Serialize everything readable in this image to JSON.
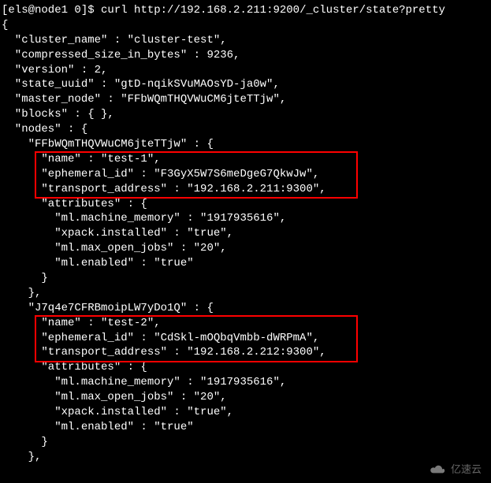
{
  "prompt": {
    "user_host": "[els@node1 0]$ ",
    "command": "curl http://192.168.2.211:9200/_cluster/state?pretty"
  },
  "lines": {
    "l0": "{",
    "l1": "  \"cluster_name\" : \"cluster-test\",",
    "l2": "  \"compressed_size_in_bytes\" : 9236,",
    "l3": "  \"version\" : 2,",
    "l4": "  \"state_uuid\" : \"gtD-nqikSVuMAOsYD-ja0w\",",
    "l5": "  \"master_node\" : \"FFbWQmTHQVWuCM6jteTTjw\",",
    "l6": "  \"blocks\" : { },",
    "l7": "  \"nodes\" : {",
    "l8": "    \"FFbWQmTHQVWuCM6jteTTjw\" : {",
    "l9": "      \"name\" : \"test-1\",",
    "l10": "      \"ephemeral_id\" : \"F3GyX5W7S6meDgeG7QkwJw\",",
    "l11": "      \"transport_address\" : \"192.168.2.211:9300\",",
    "l12": "      \"attributes\" : {",
    "l13": "        \"ml.machine_memory\" : \"1917935616\",",
    "l14": "        \"xpack.installed\" : \"true\",",
    "l15": "        \"ml.max_open_jobs\" : \"20\",",
    "l16": "        \"ml.enabled\" : \"true\"",
    "l17": "      }",
    "l18": "    },",
    "l19": "    \"J7q4e7CFRBmoipLW7yDo1Q\" : {",
    "l20": "      \"name\" : \"test-2\",",
    "l21": "      \"ephemeral_id\" : \"CdSkl-mOQbqVmbb-dWRPmA\",",
    "l22": "      \"transport_address\" : \"192.168.2.212:9300\",",
    "l23": "      \"attributes\" : {",
    "l24": "        \"ml.machine_memory\" : \"1917935616\",",
    "l25": "        \"ml.max_open_jobs\" : \"20\",",
    "l26": "        \"xpack.installed\" : \"true\",",
    "l27": "        \"ml.enabled\" : \"true\"",
    "l28": "      }",
    "l29": "    },"
  },
  "watermark": {
    "text": "亿速云"
  },
  "chart_data": {
    "type": "table",
    "title": "Elasticsearch cluster state (curl output)",
    "request_url": "http://192.168.2.211:9200/_cluster/state?pretty",
    "cluster_name": "cluster-test",
    "compressed_size_in_bytes": 9236,
    "version": 2,
    "state_uuid": "gtD-nqikSVuMAOsYD-ja0w",
    "master_node": "FFbWQmTHQVWuCM6jteTTjw",
    "blocks": {},
    "nodes": {
      "FFbWQmTHQVWuCM6jteTTjw": {
        "name": "test-1",
        "ephemeral_id": "F3GyX5W7S6meDgeG7QkwJw",
        "transport_address": "192.168.2.211:9300",
        "attributes": {
          "ml.machine_memory": "1917935616",
          "xpack.installed": "true",
          "ml.max_open_jobs": "20",
          "ml.enabled": "true"
        }
      },
      "J7q4e7CFRBmoipLW7yDo1Q": {
        "name": "test-2",
        "ephemeral_id": "CdSkl-mOQbqVmbb-dWRPmA",
        "transport_address": "192.168.2.212:9300",
        "attributes": {
          "ml.machine_memory": "1917935616",
          "ml.max_open_jobs": "20",
          "xpack.installed": "true",
          "ml.enabled": "true"
        }
      }
    }
  }
}
